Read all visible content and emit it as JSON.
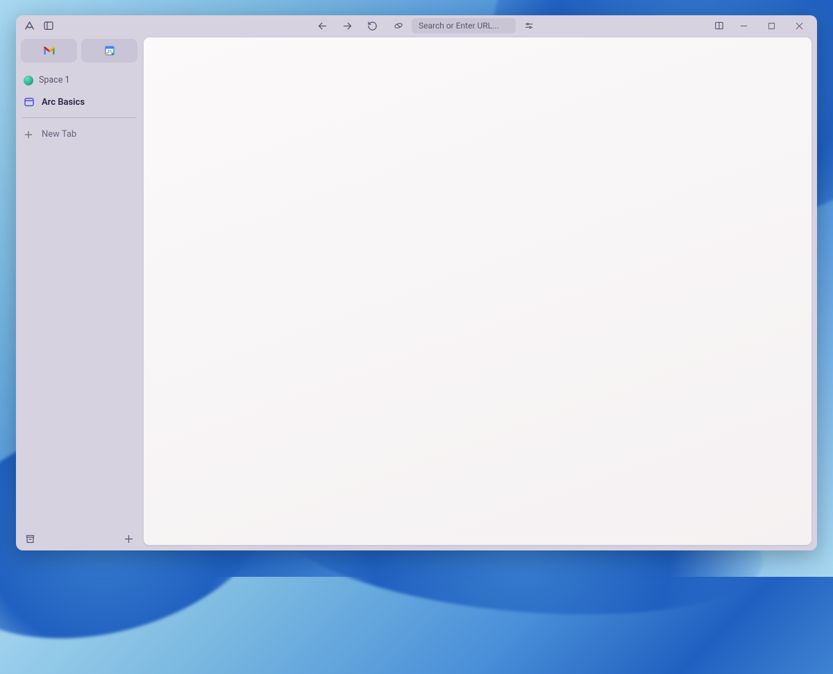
{
  "toolbar": {
    "url_placeholder": "Search or Enter URL..."
  },
  "sidebar": {
    "pinned": [
      {
        "name": "gmail"
      },
      {
        "name": "calendar"
      }
    ],
    "space_label": "Space 1",
    "tabs": [
      {
        "label": "Arc Basics"
      }
    ],
    "new_tab_label": "New Tab"
  }
}
